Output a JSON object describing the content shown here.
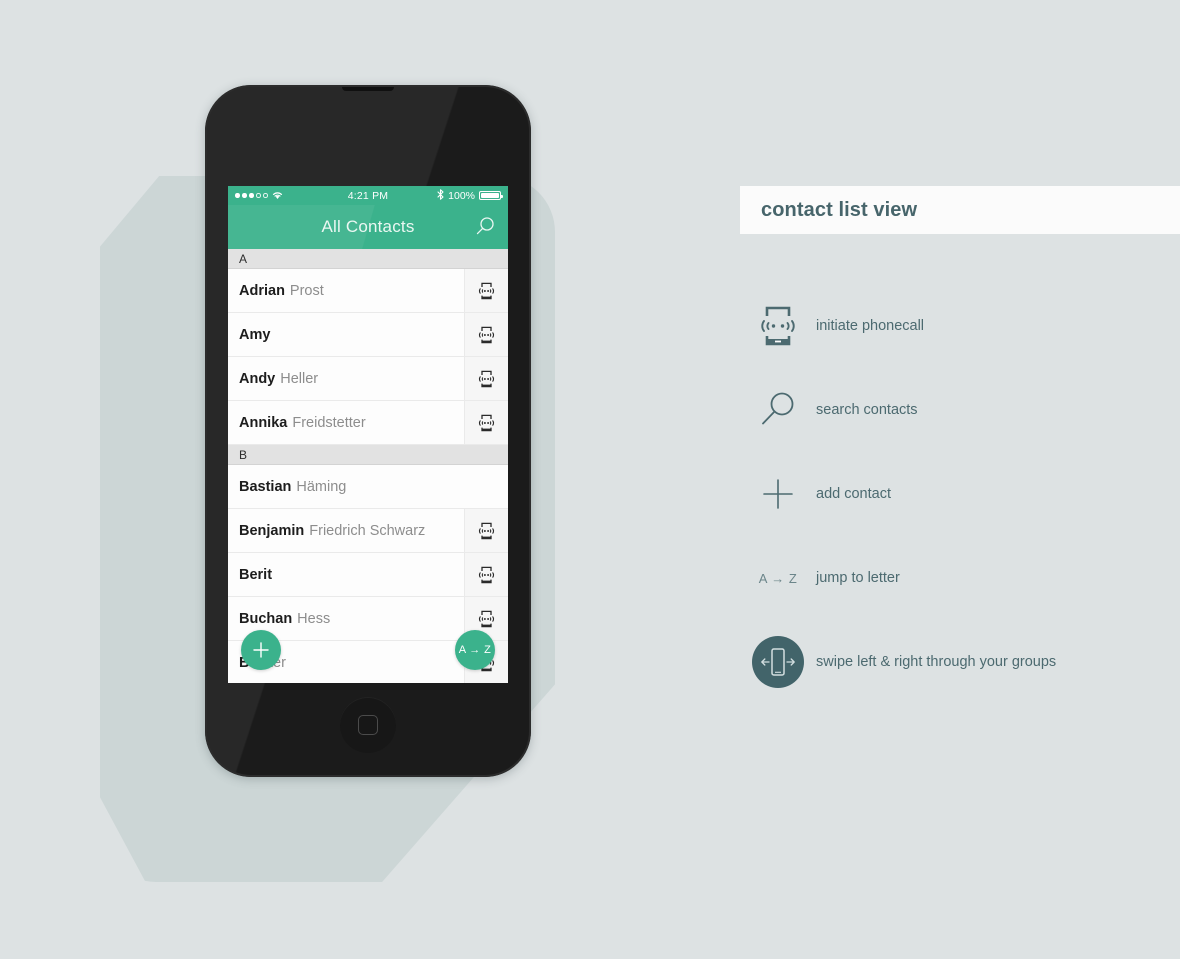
{
  "phone": {
    "status_bar": {
      "signal_dots_filled": 3,
      "signal_dots_empty": 2,
      "wifi_icon": "wifi-icon",
      "time": "4:21 PM",
      "bluetooth_icon": "bluetooth-icon",
      "battery_percent": "100%",
      "battery_icon": "battery-full-icon"
    },
    "navbar": {
      "title": "All Contacts",
      "search_icon": "search-icon"
    },
    "list": [
      {
        "type": "section",
        "letter": "A"
      },
      {
        "type": "contact",
        "first": "Adrian",
        "last": "Prost",
        "call": true
      },
      {
        "type": "contact",
        "first": "Amy",
        "last": "",
        "call": true
      },
      {
        "type": "contact",
        "first": "Andy",
        "last": "Heller",
        "call": true
      },
      {
        "type": "contact",
        "first": "Annika",
        "last": "Freidstetter",
        "call": true
      },
      {
        "type": "section",
        "letter": "B"
      },
      {
        "type": "contact",
        "first": "Bastian",
        "last": "Häming",
        "call": false
      },
      {
        "type": "contact",
        "first": "Benjamin",
        "last": "Friedrich Schwarz",
        "call": true
      },
      {
        "type": "contact",
        "first": "Berit",
        "last": "",
        "call": true
      },
      {
        "type": "contact",
        "first": "Buchan",
        "last": "Hess",
        "call": true
      },
      {
        "type": "contact",
        "first": "B",
        "last": "elker",
        "call": true
      }
    ],
    "fab_add": {
      "icon": "plus-icon"
    },
    "fab_jump": {
      "label": "A → Z"
    }
  },
  "legend": {
    "title": "contact list view",
    "items": [
      {
        "icon": "phone-call-icon",
        "label": "initiate phonecall"
      },
      {
        "icon": "search-icon",
        "label": "search contacts"
      },
      {
        "icon": "plus-icon",
        "label": "add contact"
      },
      {
        "icon": "a-to-z-text",
        "icon_text": "A → Z",
        "label": "jump to letter"
      },
      {
        "icon": "swipe-phone-icon",
        "label": "swipe left & right through your groups"
      }
    ]
  },
  "colors": {
    "accent_green": "#3bb28c",
    "background": "#dde2e3",
    "shadow": "#ccd6d6",
    "slate": "#4c6a70",
    "phone_body": "#1b1b1b"
  }
}
